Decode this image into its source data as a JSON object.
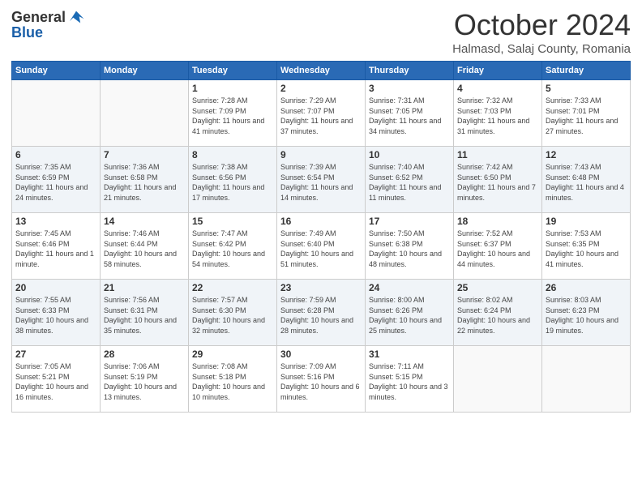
{
  "logo": {
    "general": "General",
    "blue": "Blue"
  },
  "header": {
    "month": "October 2024",
    "location": "Halmasd, Salaj County, Romania"
  },
  "days_of_week": [
    "Sunday",
    "Monday",
    "Tuesday",
    "Wednesday",
    "Thursday",
    "Friday",
    "Saturday"
  ],
  "weeks": [
    [
      {
        "day": "",
        "info": ""
      },
      {
        "day": "",
        "info": ""
      },
      {
        "day": "1",
        "info": "Sunrise: 7:28 AM\nSunset: 7:09 PM\nDaylight: 11 hours and 41 minutes."
      },
      {
        "day": "2",
        "info": "Sunrise: 7:29 AM\nSunset: 7:07 PM\nDaylight: 11 hours and 37 minutes."
      },
      {
        "day": "3",
        "info": "Sunrise: 7:31 AM\nSunset: 7:05 PM\nDaylight: 11 hours and 34 minutes."
      },
      {
        "day": "4",
        "info": "Sunrise: 7:32 AM\nSunset: 7:03 PM\nDaylight: 11 hours and 31 minutes."
      },
      {
        "day": "5",
        "info": "Sunrise: 7:33 AM\nSunset: 7:01 PM\nDaylight: 11 hours and 27 minutes."
      }
    ],
    [
      {
        "day": "6",
        "info": "Sunrise: 7:35 AM\nSunset: 6:59 PM\nDaylight: 11 hours and 24 minutes."
      },
      {
        "day": "7",
        "info": "Sunrise: 7:36 AM\nSunset: 6:58 PM\nDaylight: 11 hours and 21 minutes."
      },
      {
        "day": "8",
        "info": "Sunrise: 7:38 AM\nSunset: 6:56 PM\nDaylight: 11 hours and 17 minutes."
      },
      {
        "day": "9",
        "info": "Sunrise: 7:39 AM\nSunset: 6:54 PM\nDaylight: 11 hours and 14 minutes."
      },
      {
        "day": "10",
        "info": "Sunrise: 7:40 AM\nSunset: 6:52 PM\nDaylight: 11 hours and 11 minutes."
      },
      {
        "day": "11",
        "info": "Sunrise: 7:42 AM\nSunset: 6:50 PM\nDaylight: 11 hours and 7 minutes."
      },
      {
        "day": "12",
        "info": "Sunrise: 7:43 AM\nSunset: 6:48 PM\nDaylight: 11 hours and 4 minutes."
      }
    ],
    [
      {
        "day": "13",
        "info": "Sunrise: 7:45 AM\nSunset: 6:46 PM\nDaylight: 11 hours and 1 minute."
      },
      {
        "day": "14",
        "info": "Sunrise: 7:46 AM\nSunset: 6:44 PM\nDaylight: 10 hours and 58 minutes."
      },
      {
        "day": "15",
        "info": "Sunrise: 7:47 AM\nSunset: 6:42 PM\nDaylight: 10 hours and 54 minutes."
      },
      {
        "day": "16",
        "info": "Sunrise: 7:49 AM\nSunset: 6:40 PM\nDaylight: 10 hours and 51 minutes."
      },
      {
        "day": "17",
        "info": "Sunrise: 7:50 AM\nSunset: 6:38 PM\nDaylight: 10 hours and 48 minutes."
      },
      {
        "day": "18",
        "info": "Sunrise: 7:52 AM\nSunset: 6:37 PM\nDaylight: 10 hours and 44 minutes."
      },
      {
        "day": "19",
        "info": "Sunrise: 7:53 AM\nSunset: 6:35 PM\nDaylight: 10 hours and 41 minutes."
      }
    ],
    [
      {
        "day": "20",
        "info": "Sunrise: 7:55 AM\nSunset: 6:33 PM\nDaylight: 10 hours and 38 minutes."
      },
      {
        "day": "21",
        "info": "Sunrise: 7:56 AM\nSunset: 6:31 PM\nDaylight: 10 hours and 35 minutes."
      },
      {
        "day": "22",
        "info": "Sunrise: 7:57 AM\nSunset: 6:30 PM\nDaylight: 10 hours and 32 minutes."
      },
      {
        "day": "23",
        "info": "Sunrise: 7:59 AM\nSunset: 6:28 PM\nDaylight: 10 hours and 28 minutes."
      },
      {
        "day": "24",
        "info": "Sunrise: 8:00 AM\nSunset: 6:26 PM\nDaylight: 10 hours and 25 minutes."
      },
      {
        "day": "25",
        "info": "Sunrise: 8:02 AM\nSunset: 6:24 PM\nDaylight: 10 hours and 22 minutes."
      },
      {
        "day": "26",
        "info": "Sunrise: 8:03 AM\nSunset: 6:23 PM\nDaylight: 10 hours and 19 minutes."
      }
    ],
    [
      {
        "day": "27",
        "info": "Sunrise: 7:05 AM\nSunset: 5:21 PM\nDaylight: 10 hours and 16 minutes."
      },
      {
        "day": "28",
        "info": "Sunrise: 7:06 AM\nSunset: 5:19 PM\nDaylight: 10 hours and 13 minutes."
      },
      {
        "day": "29",
        "info": "Sunrise: 7:08 AM\nSunset: 5:18 PM\nDaylight: 10 hours and 10 minutes."
      },
      {
        "day": "30",
        "info": "Sunrise: 7:09 AM\nSunset: 5:16 PM\nDaylight: 10 hours and 6 minutes."
      },
      {
        "day": "31",
        "info": "Sunrise: 7:11 AM\nSunset: 5:15 PM\nDaylight: 10 hours and 3 minutes."
      },
      {
        "day": "",
        "info": ""
      },
      {
        "day": "",
        "info": ""
      }
    ]
  ]
}
